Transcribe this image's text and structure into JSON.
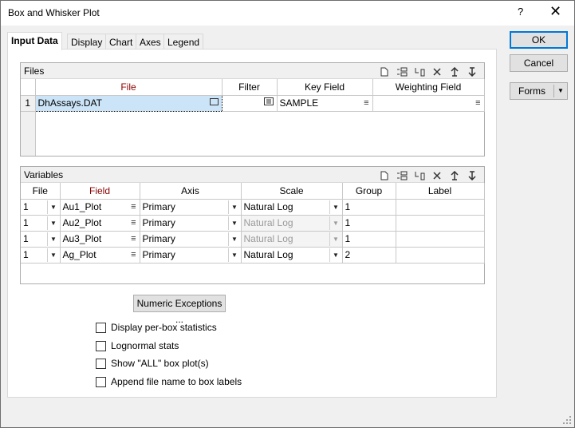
{
  "window": {
    "title": "Box and Whisker Plot",
    "help": "?",
    "close": "✕"
  },
  "tabs": [
    "Input Data",
    "Display",
    "Chart",
    "Axes",
    "Legend"
  ],
  "buttons": {
    "ok": "OK",
    "cancel": "Cancel",
    "forms": "Forms"
  },
  "files": {
    "title": "Files",
    "columns": [
      "File",
      "Filter",
      "Key Field",
      "Weighting Field"
    ],
    "rows": [
      {
        "num": "1",
        "file": "DhAssays.DAT",
        "filter": "",
        "key_field": "SAMPLE",
        "weighting_field": ""
      }
    ]
  },
  "variables": {
    "title": "Variables",
    "columns": [
      "File",
      "Field",
      "Axis",
      "Scale",
      "Group",
      "Label"
    ],
    "rows": [
      {
        "file": "1",
        "field": "Au1_Plot",
        "axis": "Primary",
        "scale": "Natural Log",
        "group": "1",
        "label": ""
      },
      {
        "file": "1",
        "field": "Au2_Plot",
        "axis": "Primary",
        "scale": "Natural Log",
        "group": "1",
        "label": ""
      },
      {
        "file": "1",
        "field": "Au3_Plot",
        "axis": "Primary",
        "scale": "Natural Log",
        "group": "1",
        "label": ""
      },
      {
        "file": "1",
        "field": "Ag_Plot",
        "axis": "Primary",
        "scale": "Natural Log",
        "group": "2",
        "label": ""
      }
    ]
  },
  "numeric_exceptions": "Numeric Exceptions ...",
  "options": [
    {
      "label": "Display per-box statistics",
      "checked": false
    },
    {
      "label": "Lognormal stats",
      "checked": false
    },
    {
      "label": "Show \"ALL\" box plot(s)",
      "checked": false
    },
    {
      "label": "Append file name to box labels",
      "checked": false
    }
  ]
}
